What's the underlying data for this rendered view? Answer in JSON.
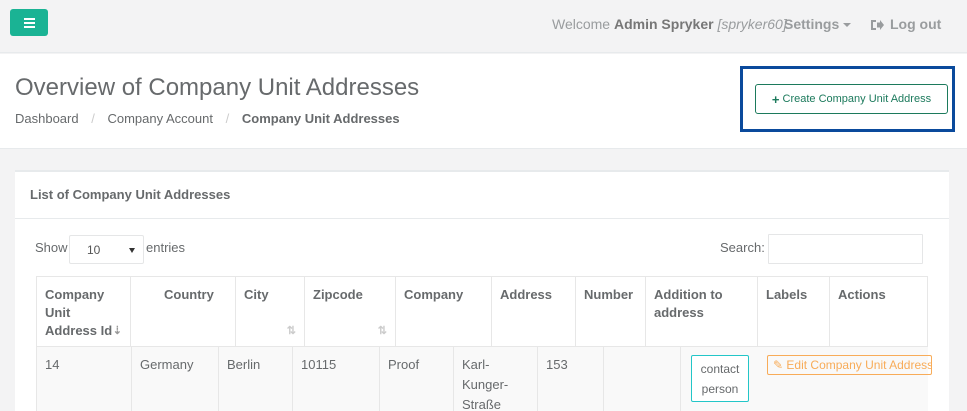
{
  "topbar": {
    "welcome_prefix": "Welcome",
    "user_name": "Admin Spryker",
    "user_login": "[spryker60]",
    "settings_label": "Settings",
    "logout_label": "Log out"
  },
  "header": {
    "title": "Overview of Company Unit Addresses",
    "breadcrumbs": [
      "Dashboard",
      "Company Account",
      "Company Unit Addresses"
    ],
    "create_button_label": "Create Company Unit Address"
  },
  "list": {
    "title": "List of Company Unit Addresses",
    "show_label": "Show",
    "page_size": "10",
    "entries_label": "entries",
    "search_label": "Search:",
    "search_value": "",
    "columns": [
      "Company Unit Address Id",
      "Country",
      "City",
      "Zipcode",
      "Company",
      "Address",
      "Number",
      "Addition to address",
      "Labels",
      "Actions"
    ],
    "rows": [
      {
        "id": "14",
        "country": "Germany",
        "city": "Berlin",
        "zipcode": "10115",
        "company": "Proof",
        "address": "Karl-Kunger-Straße",
        "number": "153",
        "addition": "",
        "label": "contact person",
        "action": "Edit Company Unit Address"
      }
    ]
  },
  "colors": {
    "accent": "#1ab394",
    "create_border": "#1c7a5c",
    "highlight": "#0a4a9c",
    "edit": "#f8ac59",
    "label_border": "#23c6c8"
  },
  "icons": [
    "menu-icon",
    "caret-down-icon",
    "sign-out-icon",
    "plus-icon",
    "sort-desc-icon",
    "sort-icon",
    "edit-icon"
  ]
}
